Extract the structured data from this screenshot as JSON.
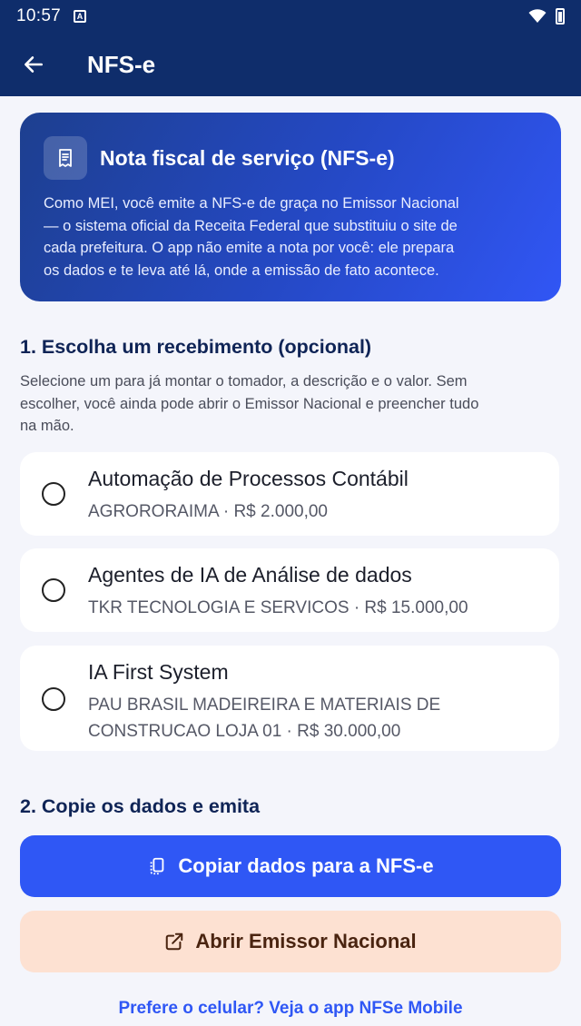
{
  "status_bar": {
    "time": "10:57",
    "notification_glyph": "A"
  },
  "app_bar": {
    "title": "NFS-e"
  },
  "hero": {
    "title": "Nota fiscal de serviço (NFS-e)",
    "lines": [
      "Como MEI, você emite a NFS-e de graça no Emissor Nacional",
      "— o sistema oficial da Receita Federal que substituiu o site de",
      "cada prefeitura. O app não emite a nota por você: ele prepara",
      "os dados e te leva até lá, onde a emissão de fato acontece."
    ]
  },
  "section1": {
    "title": "1. Escolha um recebimento (opcional)",
    "desc_lines": [
      "Selecione um para já montar o tomador, a descrição e o valor. Sem",
      "escolher, você ainda pode abrir o Emissor Nacional e preencher tudo",
      "na mão."
    ]
  },
  "receipts": [
    {
      "title": "Automação de Processos Contábil",
      "sub_lines": [
        "AGRORORAIMA · R$ 2.000,00"
      ]
    },
    {
      "title": "Agentes de IA de Análise de dados",
      "sub_lines": [
        "TKR TECNOLOGIA E SERVICOS · R$ 15.000,00"
      ]
    },
    {
      "title": "IA First System",
      "sub_lines": [
        "PAU BRASIL MADEIREIRA E MATERIAIS DE",
        "CONSTRUCAO LOJA 01 · R$ 30.000,00"
      ]
    }
  ],
  "section2": {
    "title": "2. Copie os dados e emita"
  },
  "actions": {
    "copy_label": "Copiar dados para a NFS-e",
    "open_label": "Abrir Emissor Nacional",
    "mobile_link": "Prefere o celular? Veja o app NFSe Mobile"
  },
  "icons": {
    "back": "arrow-left-icon",
    "hero": "receipt-icon",
    "copy": "copy-icon",
    "open": "open-external-icon"
  },
  "colors": {
    "app_bar": "#0f2d6b",
    "primary": "#2f57f5",
    "secondary_bg": "#fde1d2",
    "secondary_text": "#4a2410"
  }
}
